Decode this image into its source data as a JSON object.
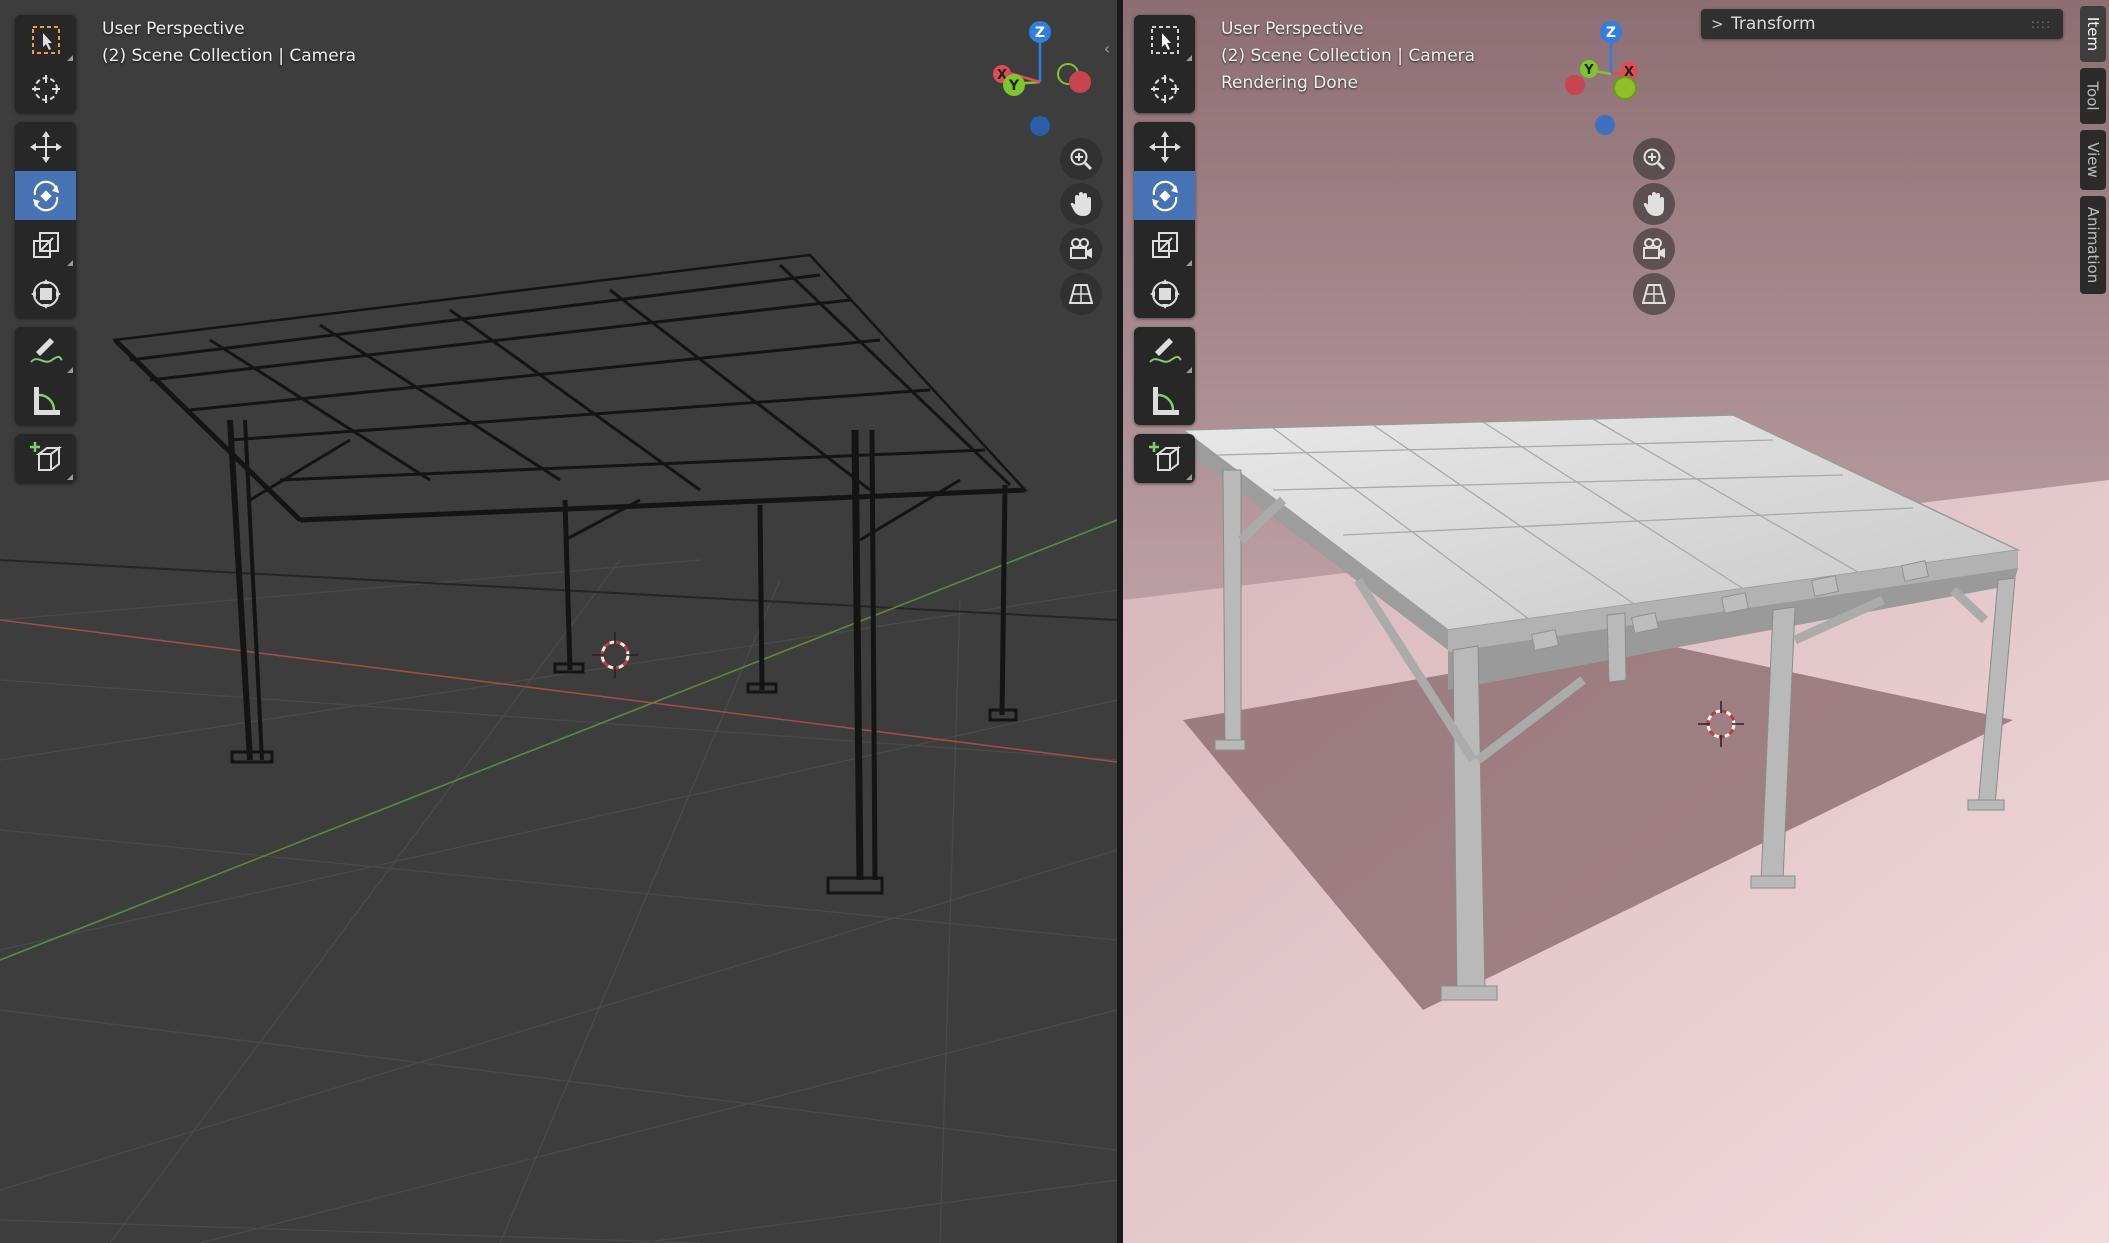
{
  "left_viewport": {
    "overlay": [
      "User Perspective",
      "(2) Scene Collection | Camera"
    ],
    "mode": "wireframe"
  },
  "right_viewport": {
    "overlay": [
      "User Perspective",
      "(2) Scene Collection | Camera",
      "Rendering Done"
    ],
    "mode": "rendered"
  },
  "toolbar": {
    "tools": [
      {
        "name": "select-box",
        "active": false
      },
      {
        "name": "cursor",
        "active": false
      },
      {
        "name": "move",
        "active": false
      },
      {
        "name": "rotate",
        "active": true
      },
      {
        "name": "scale",
        "active": false
      },
      {
        "name": "transform",
        "active": false
      },
      {
        "name": "annotate",
        "active": false
      },
      {
        "name": "measure",
        "active": false
      },
      {
        "name": "add-cube",
        "active": false
      }
    ]
  },
  "gizmo": {
    "z_label": "Z",
    "y_label": "Y",
    "x_label": "X",
    "colors": {
      "x": "#e04b56",
      "y": "#7ec62c",
      "z": "#2f7fe0"
    }
  },
  "nav_buttons": [
    "zoom-icon",
    "hand-pan-icon",
    "camera-icon",
    "grid-perspective-icon"
  ],
  "sidebar": {
    "panel_title": "Transform",
    "tabs": [
      {
        "label": "Item",
        "active": true
      },
      {
        "label": "Tool",
        "active": false
      },
      {
        "label": "View",
        "active": false
      },
      {
        "label": "Animation",
        "active": false
      }
    ]
  },
  "colors": {
    "active_tool": "#4772b3",
    "left_background": "#3d3d3d",
    "right_background": "#cdb3b8"
  }
}
